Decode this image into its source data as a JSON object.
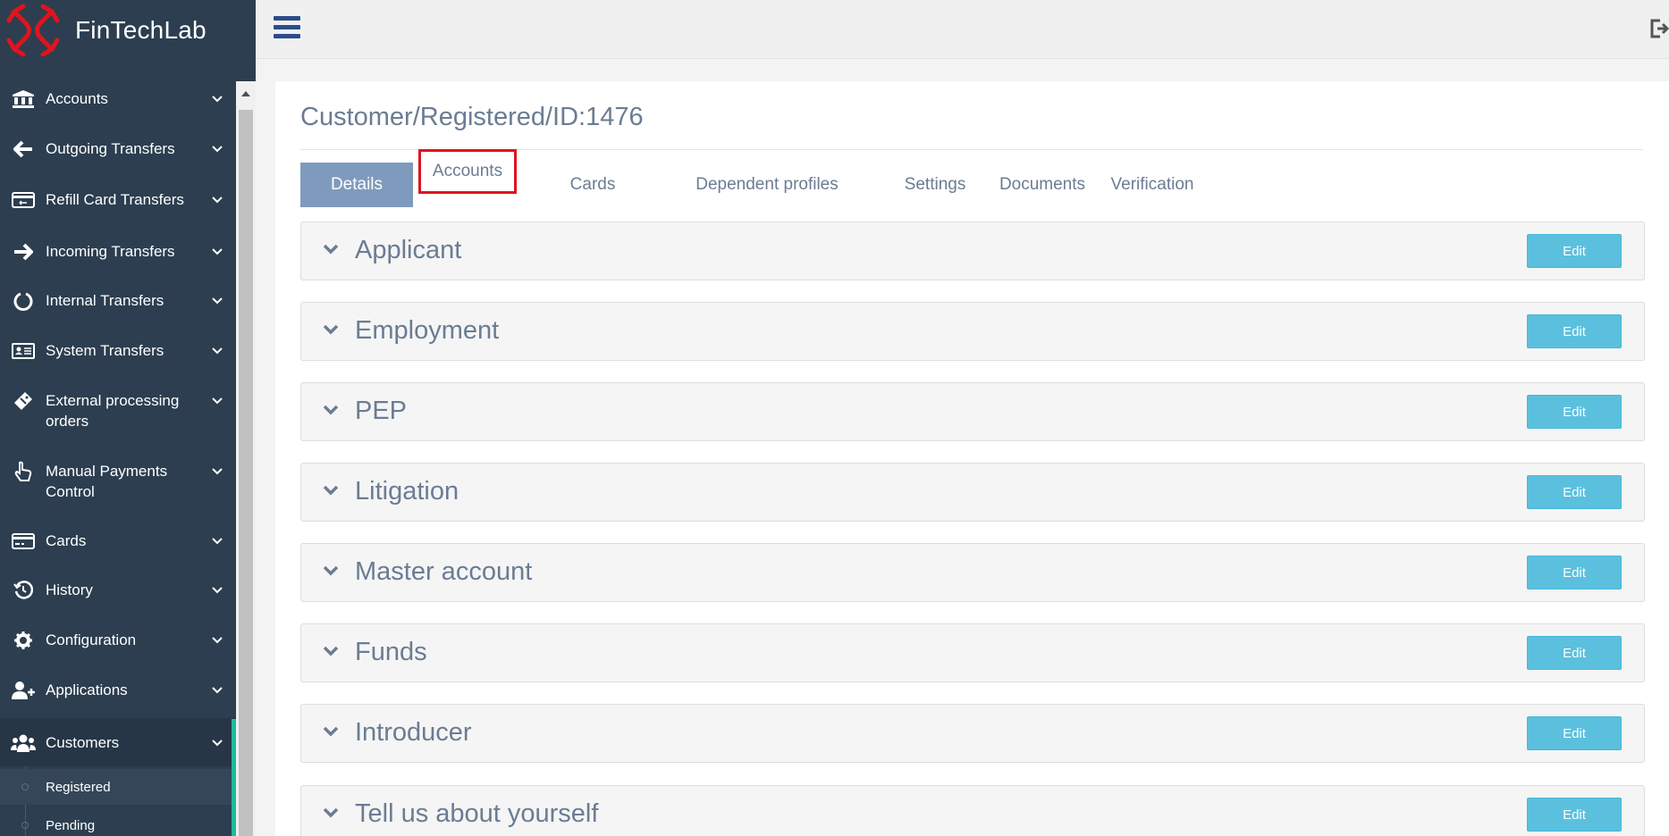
{
  "app": {
    "name": "FinTechLab"
  },
  "sidebar": {
    "items": [
      {
        "label": "Accounts",
        "icon": "bank-icon"
      },
      {
        "label": "Outgoing Transfers",
        "icon": "arrow-left-icon"
      },
      {
        "label": "Refill Card Transfers",
        "icon": "card-transfer-icon"
      },
      {
        "label": "Incoming Transfers",
        "icon": "arrow-right-icon"
      },
      {
        "label": "Internal Transfers",
        "icon": "circle-notch-icon"
      },
      {
        "label": "System Transfers",
        "icon": "id-card-icon"
      },
      {
        "label": "External processing orders",
        "icon": "ticket-icon"
      },
      {
        "label": "Manual Payments Control",
        "icon": "hand-pointer-icon"
      },
      {
        "label": "Cards",
        "icon": "credit-card-icon"
      },
      {
        "label": "History",
        "icon": "history-icon"
      },
      {
        "label": "Configuration",
        "icon": "gear-icon"
      },
      {
        "label": "Applications",
        "icon": "user-plus-icon"
      },
      {
        "label": "Customers",
        "icon": "users-icon"
      }
    ],
    "sub_items": [
      {
        "label": "Registered"
      },
      {
        "label": "Pending"
      }
    ]
  },
  "page": {
    "title": "Customer/Registered/ID:1476"
  },
  "tabs": [
    {
      "label": "Details"
    },
    {
      "label": "Accounts"
    },
    {
      "label": "Cards"
    },
    {
      "label": "Dependent profiles"
    },
    {
      "label": "Settings"
    },
    {
      "label": "Documents"
    },
    {
      "label": "Verification"
    }
  ],
  "panels": [
    {
      "title": "Applicant",
      "edit_label": "Edit"
    },
    {
      "title": "Employment",
      "edit_label": "Edit"
    },
    {
      "title": "PEP",
      "edit_label": "Edit"
    },
    {
      "title": "Litigation",
      "edit_label": "Edit"
    },
    {
      "title": "Master account",
      "edit_label": "Edit"
    },
    {
      "title": "Funds",
      "edit_label": "Edit"
    },
    {
      "title": "Introducer",
      "edit_label": "Edit"
    },
    {
      "title": "Tell us about yourself",
      "edit_label": "Edit"
    }
  ],
  "colors": {
    "sidebar": "#2c3e50",
    "logo_red": "#e0141e",
    "active_tab": "#7e9bbd",
    "edit_button": "#5bc0de",
    "highlight_box": "#e0141e",
    "active_indicator": "#1abc9c"
  }
}
